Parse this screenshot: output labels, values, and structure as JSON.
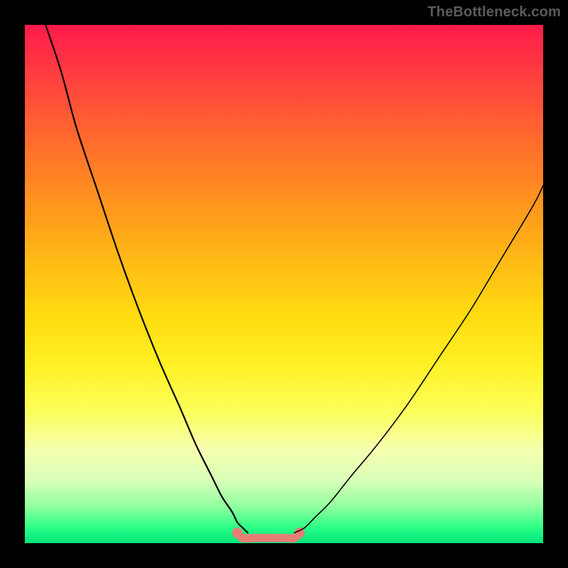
{
  "watermark": "TheBottleneck.com",
  "chart_data": {
    "type": "line",
    "title": "",
    "xlabel": "",
    "ylabel": "",
    "xlim": [
      0,
      100
    ],
    "ylim": [
      0,
      100
    ],
    "grid": false,
    "legend": false,
    "series": [
      {
        "name": "left-curve",
        "x": [
          4,
          7,
          10,
          14,
          18,
          22,
          26,
          30,
          33,
          36,
          38,
          40,
          41,
          42,
          43
        ],
        "values": [
          100,
          91,
          80,
          68,
          56,
          45,
          35,
          26,
          19,
          13,
          9,
          6,
          4,
          3,
          2
        ]
      },
      {
        "name": "right-curve",
        "x": [
          52,
          54,
          56,
          59,
          63,
          68,
          74,
          80,
          86,
          92,
          98,
          100
        ],
        "values": [
          2,
          3,
          5,
          8,
          13,
          19,
          27,
          36,
          45,
          55,
          65,
          69
        ]
      },
      {
        "name": "bottom-band",
        "x": [
          41,
          42,
          44,
          46,
          48,
          50,
          52,
          53
        ],
        "values": [
          2,
          1,
          1,
          1,
          1,
          1,
          1,
          2
        ]
      }
    ],
    "band_thickness_pct": 1.6,
    "colors": {
      "curve": "#000000",
      "band": "#e57f75"
    }
  }
}
